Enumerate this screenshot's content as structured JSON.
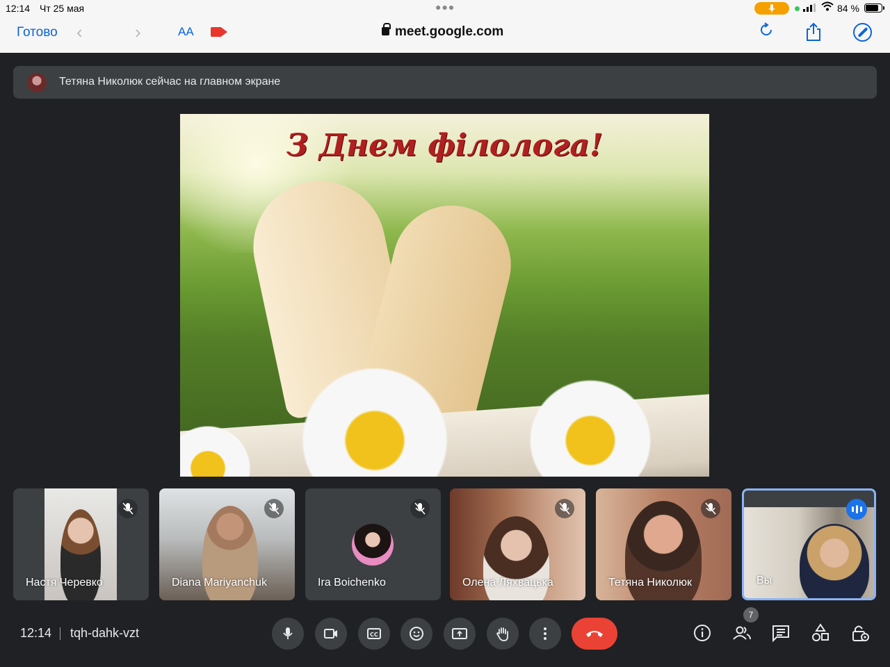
{
  "status_bar": {
    "time": "12:14",
    "date": "Чт 25 мая",
    "battery_percent": "84 %",
    "battery_level": 0.84
  },
  "browser": {
    "done_label": "Готово",
    "text_size_label": "AA",
    "url": "meet.google.com"
  },
  "banner": {
    "text": "Тетяна Николюк сейчас на главном экране"
  },
  "presentation": {
    "title": "З Днем філолога!"
  },
  "participants": [
    {
      "name": "Настя Черевко",
      "muted": true
    },
    {
      "name": "Diana Mariyanchuk",
      "muted": true
    },
    {
      "name": "Ira Boichenko",
      "muted": true
    },
    {
      "name": "Олена Ляхвацька",
      "muted": true
    },
    {
      "name": "Тетяна Николюк",
      "muted": true
    },
    {
      "name": "Вы",
      "muted": false,
      "speaking": true
    }
  ],
  "meeting": {
    "time": "12:14",
    "code": "tqh-dahk-vzt",
    "participant_count": "7"
  },
  "colors": {
    "background": "#202124",
    "tile": "#3c4043",
    "hangup": "#ea4335",
    "accent": "#1a73e8",
    "ios_blue": "#0a64d8"
  },
  "icons": {
    "controls": [
      "mic-icon",
      "camera-icon",
      "captions-icon",
      "emoji-icon",
      "present-screen-icon",
      "raise-hand-icon",
      "more-options-icon",
      "hangup-icon"
    ],
    "right": [
      "info-icon",
      "people-icon",
      "chat-icon",
      "activities-icon",
      "host-controls-icon"
    ]
  }
}
